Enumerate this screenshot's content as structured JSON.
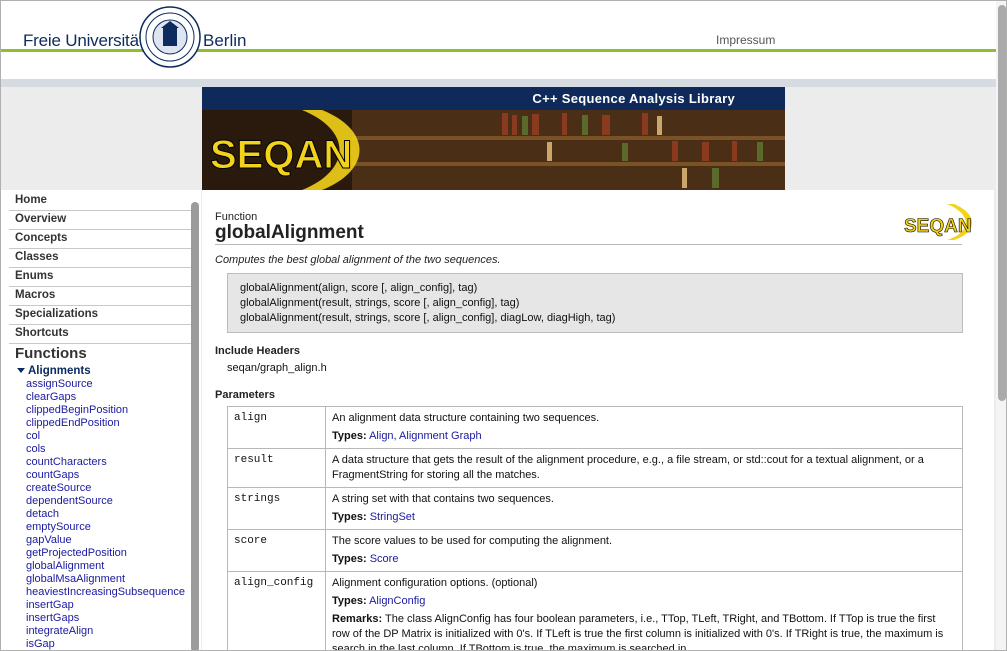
{
  "header": {
    "fu_left": "Freie Universität",
    "fu_right": "Berlin",
    "impressum": "Impressum"
  },
  "banner": {
    "subtitle": "C++ Sequence Analysis Library",
    "logo_text": "SEQAN"
  },
  "sidebar": {
    "nav": [
      "Home",
      "Overview",
      "Concepts",
      "Classes",
      "Enums",
      "Macros",
      "Specializations",
      "Shortcuts"
    ],
    "functions_heading": "Functions",
    "group_label": "Alignments",
    "functions": [
      "assignSource",
      "clearGaps",
      "clippedBeginPosition",
      "clippedEndPosition",
      "col",
      "cols",
      "countCharacters",
      "countGaps",
      "createSource",
      "dependentSource",
      "detach",
      "emptySource",
      "gapValue",
      "getProjectedPosition",
      "globalAlignment",
      "globalMsaAlignment",
      "heaviestIncreasingSubsequence",
      "insertGap",
      "insertGaps",
      "integrateAlign",
      "isGap"
    ]
  },
  "main": {
    "kind": "Function",
    "title": "globalAlignment",
    "summary": "Computes the best global alignment of the two sequences.",
    "signatures": [
      "globalAlignment(align, score [, align_config], tag)",
      "globalAlignment(result, strings, score [, align_config], tag)",
      "globalAlignment(result, strings, score [, align_config], diagLow, diagHigh, tag)"
    ],
    "include_heading": "Include Headers",
    "include_value": "seqan/graph_align.h",
    "params_heading": "Parameters",
    "types_label": "Types:",
    "remarks_label": "Remarks:",
    "params": [
      {
        "name": "align",
        "desc": "An alignment data structure containing two sequences.",
        "types": "Align, Alignment Graph"
      },
      {
        "name": "result",
        "desc": "A data structure that gets the result of the alignment procedure, e.g., a file stream, or std::cout for a textual alignment, or a FragmentString for storing all the matches.",
        "types": ""
      },
      {
        "name": "strings",
        "desc": "A string set with that contains two sequences.",
        "types": "StringSet"
      },
      {
        "name": "score",
        "desc": "The score values to be used for computing the alignment.",
        "types": "Score"
      },
      {
        "name": "align_config",
        "desc": "Alignment configuration options. (optional)",
        "types": "AlignConfig",
        "remarks": "The class AlignConfig has four boolean parameters, i.e., TTop, TLeft, TRight, and TBottom. If TTop is true the first row of the DP Matrix is initialized with 0's. If TLeft is true the first column is initialized with 0's. If TRight is true, the maximum is search in the last column. If TBottom is true, the maximum is searched in"
      }
    ]
  },
  "colors": {
    "brand_navy": "#0f2a5a",
    "fu_green": "#8fbf2a",
    "link": "#1a1aa0",
    "seqan_yellow": "#f2d21a"
  }
}
